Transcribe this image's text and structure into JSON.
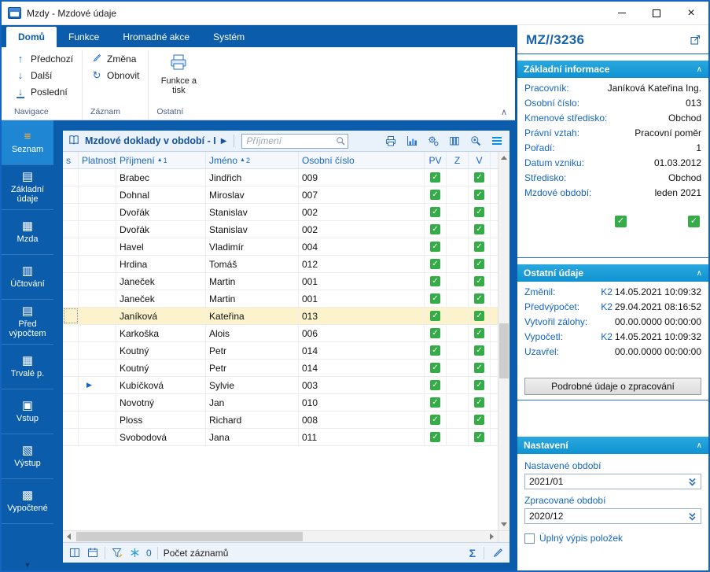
{
  "window": {
    "title": "Mzdy - Mzdové údaje"
  },
  "icons": {
    "sort_asc": "▲",
    "play": "▶",
    "check": "✓",
    "chevron_up": "∧",
    "chevron_down": "▼",
    "arrow_up": "↑",
    "arrow_down": "↓",
    "refresh": "↻",
    "sigma": "Σ",
    "close": "×"
  },
  "ribbon": {
    "tabs": [
      {
        "label": "Domů",
        "active": true
      },
      {
        "label": "Funkce",
        "active": false
      },
      {
        "label": "Hromadné akce",
        "active": false
      },
      {
        "label": "Systém",
        "active": false
      }
    ],
    "navigace": {
      "label": "Navigace",
      "previous": "Předchozí",
      "next": "Další",
      "last": "Poslední"
    },
    "zaznam": {
      "label": "Záznam",
      "change": "Změna",
      "refresh": "Obnovit"
    },
    "ostatni": {
      "label": "Ostatní",
      "print": "Funkce a tisk"
    }
  },
  "sidebar": {
    "items": [
      {
        "label": "Seznam",
        "glyph": "≡",
        "active": true
      },
      {
        "label": "Základní údaje",
        "glyph": "▤",
        "active": false
      },
      {
        "label": "Mzda",
        "glyph": "▦",
        "active": false
      },
      {
        "label": "Účtování",
        "glyph": "▥",
        "active": false
      },
      {
        "label": "Před výpočtem",
        "glyph": "▤",
        "active": false
      },
      {
        "label": "Trvalé p.",
        "glyph": "▦",
        "active": false
      },
      {
        "label": "Vstup",
        "glyph": "▣",
        "active": false
      },
      {
        "label": "Výstup",
        "glyph": "▧",
        "active": false
      },
      {
        "label": "Vypočtené",
        "glyph": "▩",
        "active": false
      }
    ]
  },
  "grid": {
    "title": "Mzdové doklady v období - I",
    "search_placeholder": "Příjmení",
    "columns": {
      "s": "s",
      "platnost": "Platnost",
      "prijmeni": "Příjmení",
      "jmeno": "Jméno",
      "osobni_cislo": "Osobní číslo",
      "pv": "PV",
      "z": "Z",
      "v": "V"
    },
    "sort": {
      "prijmeni": "1",
      "jmeno": "2"
    },
    "rows": [
      {
        "surname": "Brabec",
        "name": "Jindřich",
        "number": "009",
        "pv": true,
        "v": true,
        "play": false,
        "selected": false
      },
      {
        "surname": "Dohnal",
        "name": "Miroslav",
        "number": "007",
        "pv": true,
        "v": true,
        "play": false,
        "selected": false
      },
      {
        "surname": "Dvořák",
        "name": "Stanislav",
        "number": "002",
        "pv": true,
        "v": true,
        "play": false,
        "selected": false
      },
      {
        "surname": "Dvořák",
        "name": "Stanislav",
        "number": "002",
        "pv": true,
        "v": true,
        "play": false,
        "selected": false
      },
      {
        "surname": "Havel",
        "name": "Vladimír",
        "number": "004",
        "pv": true,
        "v": true,
        "play": false,
        "selected": false
      },
      {
        "surname": "Hrdina",
        "name": "Tomáš",
        "number": "012",
        "pv": true,
        "v": true,
        "play": false,
        "selected": false
      },
      {
        "surname": "Janeček",
        "name": "Martin",
        "number": "001",
        "pv": true,
        "v": true,
        "play": false,
        "selected": false
      },
      {
        "surname": "Janeček",
        "name": "Martin",
        "number": "001",
        "pv": true,
        "v": true,
        "play": false,
        "selected": false
      },
      {
        "surname": "Janíková",
        "name": "Kateřina",
        "number": "013",
        "pv": true,
        "v": true,
        "play": false,
        "selected": true
      },
      {
        "surname": "Karkoška",
        "name": "Alois",
        "number": "006",
        "pv": true,
        "v": true,
        "play": false,
        "selected": false
      },
      {
        "surname": "Koutný",
        "name": "Petr",
        "number": "014",
        "pv": true,
        "v": true,
        "play": false,
        "selected": false
      },
      {
        "surname": "Koutný",
        "name": "Petr",
        "number": "014",
        "pv": true,
        "v": true,
        "play": false,
        "selected": false
      },
      {
        "surname": "Kubíčková",
        "name": "Sylvie",
        "number": "003",
        "pv": true,
        "v": true,
        "play": true,
        "selected": false
      },
      {
        "surname": "Novotný",
        "name": "Jan",
        "number": "010",
        "pv": true,
        "v": true,
        "play": false,
        "selected": false
      },
      {
        "surname": "Ploss",
        "name": "Richard",
        "number": "008",
        "pv": true,
        "v": true,
        "play": false,
        "selected": false
      },
      {
        "surname": "Svobodová",
        "name": "Jana",
        "number": "011",
        "pv": true,
        "v": true,
        "play": false,
        "selected": false
      }
    ],
    "statusbar": {
      "filter_count": "0",
      "count_label": "Počet záznamů"
    }
  },
  "detail": {
    "doc_id": "MZ//3236",
    "basic": {
      "title": "Základní informace",
      "rows": [
        {
          "label": "Pracovník:",
          "prefix": "",
          "value": "Janíková Kateřina Ing."
        },
        {
          "label": "Osobní číslo:",
          "prefix": "",
          "value": "013"
        },
        {
          "label": "Kmenové středisko:",
          "prefix": "",
          "value": "Obchod"
        },
        {
          "label": "Právní vztah:",
          "prefix": "",
          "value": "Pracovní poměr"
        },
        {
          "label": "Pořadí:",
          "prefix": "",
          "value": "1"
        },
        {
          "label": "Datum vzniku:",
          "prefix": "",
          "value": "01.03.2012"
        },
        {
          "label": "Středisko:",
          "prefix": "",
          "value": "Obchod"
        },
        {
          "label": "Mzdové období:",
          "prefix": "",
          "value": "leden 2021"
        }
      ]
    },
    "other": {
      "title": "Ostatní údaje",
      "rows": [
        {
          "label": "Změnil:",
          "prefix": "K2",
          "value": "14.05.2021 10:09:32"
        },
        {
          "label": "Předvýpočet:",
          "prefix": "K2",
          "value": "29.04.2021 08:16:52"
        },
        {
          "label": "Vytvořil zálohy:",
          "prefix": "",
          "value": "00.00.0000 00:00:00"
        },
        {
          "label": "Vypočetl:",
          "prefix": "K2",
          "value": "14.05.2021 10:09:32"
        },
        {
          "label": "Uzavřel:",
          "prefix": "",
          "value": "00.00.0000 00:00:00"
        }
      ],
      "details_button": "Podrobné údaje o zpracování"
    },
    "settings": {
      "title": "Nastavení",
      "fields": [
        {
          "label": "Nastavené období",
          "value": "2021/01"
        },
        {
          "label": "Zpracované období",
          "value": "2020/12"
        }
      ],
      "checkbox_label": "Úplný výpis položek",
      "checkbox_checked": false
    }
  }
}
